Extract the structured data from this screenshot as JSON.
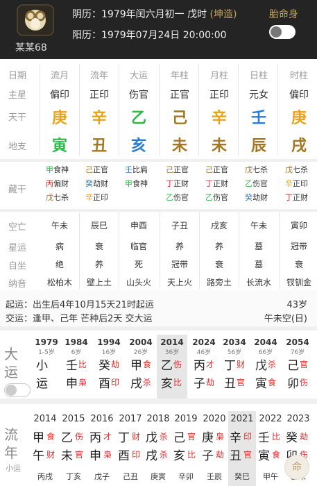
{
  "header": {
    "name": "某某68",
    "lunar_prefix": "阴历：1979年闰六月初一 戊时",
    "lunar_tag": "(坤造)",
    "solar": "阳历：1979年07月24日 20:00:00",
    "taimingshen": "胎命身"
  },
  "table": {
    "row_labels": [
      "日期",
      "主星",
      "天干",
      "地支"
    ],
    "cols": [
      {
        "head": "流月",
        "star": "偏印",
        "gan": "庚",
        "zhi": "寅"
      },
      {
        "head": "流年",
        "star": "正印",
        "gan": "辛",
        "zhi": "丑"
      },
      {
        "head": "大运",
        "star": "伤官",
        "gan": "乙",
        "zhi": "亥"
      },
      {
        "head": "年柱",
        "star": "正官",
        "gan": "己",
        "zhi": "未"
      },
      {
        "head": "月柱",
        "star": "正印",
        "gan": "辛",
        "zhi": "未"
      },
      {
        "head": "日柱",
        "star": "元女",
        "gan": "壬",
        "zhi": "辰"
      },
      {
        "head": "时柱",
        "star": "偏印",
        "gan": "庚",
        "zhi": "戌"
      }
    ]
  },
  "canggan": {
    "label": "藏干",
    "cols": [
      [
        [
          "甲",
          "食神"
        ],
        [
          "丙",
          "偏财"
        ],
        [
          "戊",
          "七杀"
        ]
      ],
      [
        [
          "己",
          "正官"
        ],
        [
          "癸",
          "劫财"
        ],
        [
          "辛",
          "正印"
        ]
      ],
      [
        [
          "壬",
          "比肩"
        ],
        [
          "甲",
          "食神"
        ]
      ],
      [
        [
          "己",
          "正官"
        ],
        [
          "丁",
          "正财"
        ],
        [
          "乙",
          "伤官"
        ]
      ],
      [
        [
          "己",
          "正官"
        ],
        [
          "丁",
          "正财"
        ],
        [
          "乙",
          "伤官"
        ]
      ],
      [
        [
          "戊",
          "七杀"
        ],
        [
          "乙",
          "伤官"
        ],
        [
          "癸",
          "劫财"
        ]
      ],
      [
        [
          "戊",
          "七杀"
        ],
        [
          "辛",
          "正印"
        ],
        [
          "丁",
          "正财"
        ]
      ]
    ]
  },
  "misc": {
    "row_labels": [
      "空亡",
      "星运",
      "自坐",
      "纳音"
    ],
    "cols": [
      [
        "午未",
        "病",
        "绝",
        "松柏木"
      ],
      [
        "辰巳",
        "衰",
        "养",
        "壁上土"
      ],
      [
        "申酉",
        "临官",
        "死",
        "山头火"
      ],
      [
        "子丑",
        "养",
        "冠带",
        "天上火"
      ],
      [
        "戌亥",
        "养",
        "衰",
        "路旁土"
      ],
      [
        "午未",
        "墓",
        "墓",
        "长流水"
      ],
      [
        "寅卯",
        "冠带",
        "衰",
        "钗钏金"
      ]
    ]
  },
  "qiyun": {
    "line1": "起运：出生后4年10月15天21时起运",
    "age": "43岁",
    "line2": "交运：逢甲、己年 芒种后2天 交大运",
    "kong": "午未空(日)"
  },
  "dayun": {
    "title": [
      "大",
      "运"
    ],
    "cols": [
      {
        "year": "1979",
        "age": "1-5岁",
        "gan": "小",
        "zhi": "运",
        "s1": "",
        "s2": ""
      },
      {
        "year": "1984",
        "age": "6岁",
        "gan": "壬",
        "zhi": "申",
        "s1": "比",
        "s2": "枭"
      },
      {
        "year": "1994",
        "age": "16岁",
        "gan": "癸",
        "zhi": "酉",
        "s1": "劫",
        "s2": "印"
      },
      {
        "year": "2004",
        "age": "26岁",
        "gan": "甲",
        "zhi": "戌",
        "s1": "食",
        "s2": "杀"
      },
      {
        "year": "2014",
        "age": "36岁",
        "gan": "乙",
        "zhi": "亥",
        "s1": "伤",
        "s2": "比"
      },
      {
        "year": "2024",
        "age": "46岁",
        "gan": "丙",
        "zhi": "子",
        "s1": "才",
        "s2": "劫"
      },
      {
        "year": "2034",
        "age": "56岁",
        "gan": "丁",
        "zhi": "丑",
        "s1": "财",
        "s2": "官"
      },
      {
        "year": "2044",
        "age": "66岁",
        "gan": "戊",
        "zhi": "寅",
        "s1": "杀",
        "s2": "食"
      },
      {
        "year": "2054",
        "age": "76岁",
        "gan": "己",
        "zhi": "卯",
        "s1": "官",
        "s2": "伤"
      }
    ]
  },
  "liunian": {
    "title": [
      "流",
      "年"
    ],
    "subtitle": "小运",
    "cols": [
      {
        "year": "2014",
        "gan": "甲",
        "zhi": "午",
        "s1": "食",
        "s2": "财",
        "xy": "丙戌"
      },
      {
        "year": "2015",
        "gan": "乙",
        "zhi": "未",
        "s1": "伤",
        "s2": "官",
        "xy": "丁亥"
      },
      {
        "year": "2016",
        "gan": "丙",
        "zhi": "申",
        "s1": "才",
        "s2": "枭",
        "xy": "戊子"
      },
      {
        "year": "2017",
        "gan": "丁",
        "zhi": "酉",
        "s1": "财",
        "s2": "印",
        "xy": "己丑"
      },
      {
        "year": "2018",
        "gan": "戊",
        "zhi": "戌",
        "s1": "杀",
        "s2": "杀",
        "xy": "庚寅"
      },
      {
        "year": "2019",
        "gan": "己",
        "zhi": "亥",
        "s1": "官",
        "s2": "比",
        "xy": "辛卯"
      },
      {
        "year": "2020",
        "gan": "庚",
        "zhi": "子",
        "s1": "枭",
        "s2": "劫",
        "xy": "壬辰"
      },
      {
        "year": "2021",
        "gan": "辛",
        "zhi": "丑",
        "s1": "印",
        "s2": "官",
        "xy": "癸巳"
      },
      {
        "year": "2022",
        "gan": "壬",
        "zhi": "寅",
        "s1": "比",
        "s2": "食",
        "xy": "甲午"
      },
      {
        "year": "2023",
        "gan": "癸",
        "zhi": "卯",
        "s1": "劫",
        "s2": "伤",
        "xy": "乙未"
      }
    ]
  },
  "fab": "命"
}
